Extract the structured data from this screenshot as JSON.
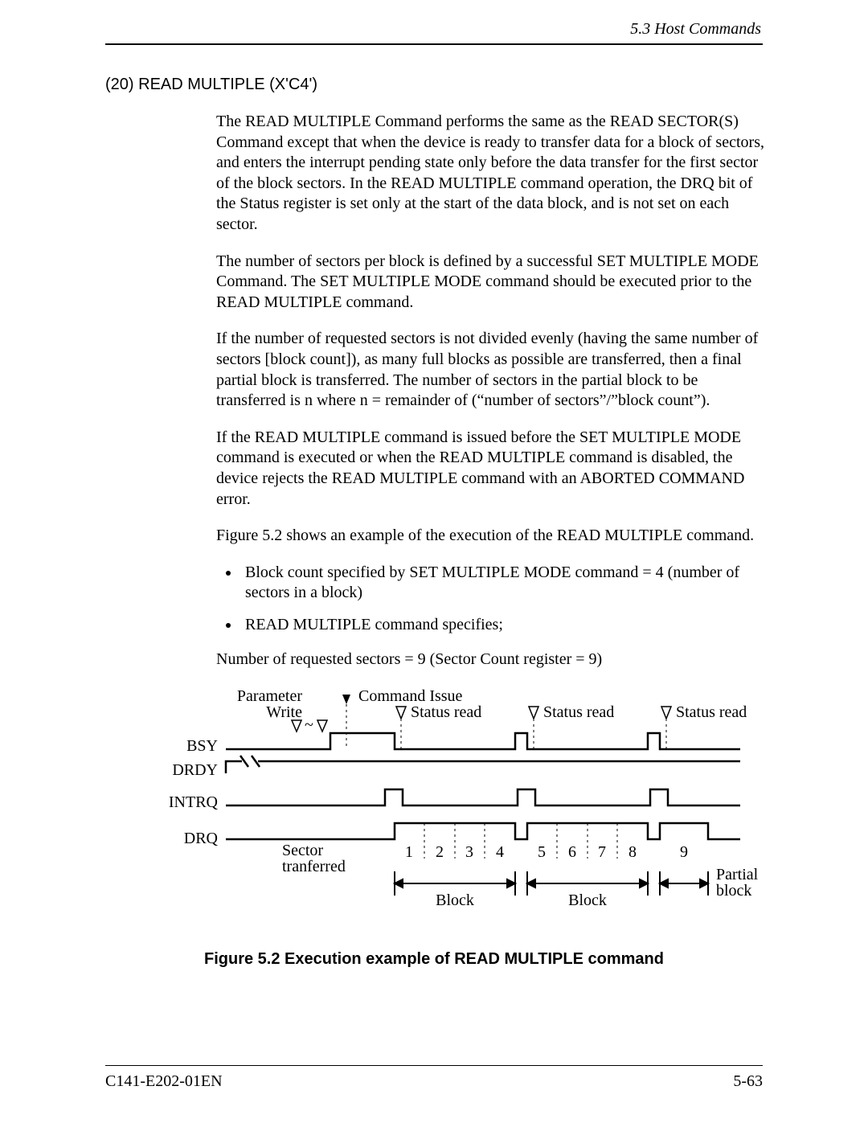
{
  "header": "5.3  Host Commands",
  "section_title": "(20)  READ MULTIPLE (X'C4')",
  "paragraphs": {
    "p1": "The READ MULTIPLE Command performs the same as the READ SECTOR(S) Command except that when the device is ready to transfer data for a block of sectors, and enters the interrupt pending state only before the data transfer for the first sector of the block sectors.  In the READ MULTIPLE command operation, the DRQ bit of the Status register is set only at the start of the data block, and is not set on each sector.",
    "p2": "The number of sectors per block is defined by a successful SET MULTIPLE MODE Command.  The SET MULTIPLE MODE command should be executed prior to the READ MULTIPLE command.",
    "p3": "If the number of requested sectors is not divided evenly (having the same number of sectors [block count]), as many full blocks as possible are transferred, then a final partial block is transferred. The number of sectors in the partial block to be transferred is n where n = remainder of (“number of sectors”/”block count”).",
    "p4": "If the READ MULTIPLE command is issued before the SET MULTIPLE MODE command is executed or when the READ MULTIPLE command is disabled, the device rejects the READ MULTIPLE command with an ABORTED COMMAND error.",
    "p5": "Figure 5.2 shows an example of the execution of the READ MULTIPLE command.",
    "b1": "Block count specified by SET MULTIPLE MODE command = 4 (number of sectors in a block)",
    "b2": "READ MULTIPLE command specifies;",
    "p6": "Number of requested sectors = 9 (Sector Count register = 9)"
  },
  "figure": {
    "parameter_write": "Parameter\nWrite",
    "command_issue": "Command Issue",
    "status_read": "Status read",
    "signals": {
      "bsy": "BSY",
      "drdy": "DRDY",
      "intrq": "INTRQ",
      "drq": "DRQ"
    },
    "sector_transferred": "Sector\ntranferred",
    "nums": [
      "1",
      "2",
      "3",
      "4",
      "5",
      "6",
      "7",
      "8",
      "9"
    ],
    "block": "Block",
    "partial": "Partial\nblock"
  },
  "caption": "Figure 5.2  Execution example of READ MULTIPLE command",
  "footer": {
    "left": "C141-E202-01EN",
    "right": "5-63"
  }
}
